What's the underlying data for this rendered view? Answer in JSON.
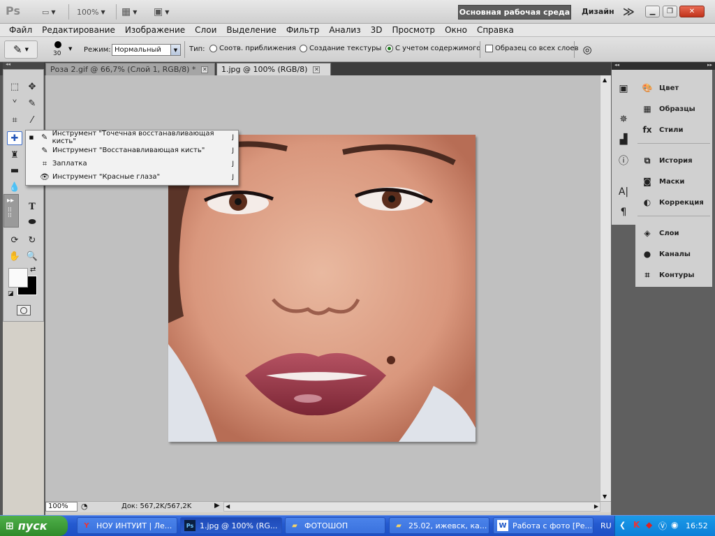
{
  "app": {
    "logo": "Ps",
    "zoom_preset": "100%",
    "workspace": "Основная рабочая среда",
    "workspace_alt": "Дизайн",
    "more": "≫"
  },
  "menu": [
    "Файл",
    "Редактирование",
    "Изображение",
    "Слои",
    "Выделение",
    "Фильтр",
    "Анализ",
    "3D",
    "Просмотр",
    "Окно",
    "Справка"
  ],
  "options": {
    "brush_size": "30",
    "mode_label": "Режим:",
    "mode_value": "Нормальный",
    "type_label": "Тип:",
    "radio_proximity": "Соотв. приближения",
    "radio_texture": "Создание текстуры",
    "radio_content": "С учетом содержимого",
    "sample_all_layers": "Образец со всех слоев"
  },
  "tabs": [
    {
      "title": "Роза 2.gif @ 66,7% (Слой 1, RGB/8) *",
      "active": false
    },
    {
      "title": "1.jpg @ 100% (RGB/8)",
      "active": true
    }
  ],
  "flyout": [
    {
      "label": "Инструмент \"Точечная восстанавливающая кисть\"",
      "key": "J",
      "selected": true
    },
    {
      "label": "Инструмент \"Восстанавливающая кисть\"",
      "key": "J",
      "selected": false
    },
    {
      "label": "Заплатка",
      "key": "J",
      "selected": false
    },
    {
      "label": "Инструмент \"Красные глаза\"",
      "key": "J",
      "selected": false
    }
  ],
  "status": {
    "zoom": "100%",
    "doc": "Док: 567,2K/567,2K"
  },
  "panels": [
    {
      "label": "Цвет",
      "icon": "color-icon"
    },
    {
      "label": "Образцы",
      "icon": "swatches-icon"
    },
    {
      "label": "Стили",
      "icon": "styles-icon"
    },
    {
      "label": "История",
      "icon": "history-icon"
    },
    {
      "label": "Маски",
      "icon": "masks-icon"
    },
    {
      "label": "Коррекция",
      "icon": "adjustments-icon"
    },
    {
      "label": "Слои",
      "icon": "layers-icon"
    },
    {
      "label": "Каналы",
      "icon": "channels-icon"
    },
    {
      "label": "Контуры",
      "icon": "paths-icon"
    }
  ],
  "taskbar": {
    "start": "пуск",
    "tasks": [
      {
        "label": "НОУ ИНТУИТ | Ле...",
        "icon": "yandex-browser-icon"
      },
      {
        "label": "1.jpg @ 100% (RG...",
        "icon": "photoshop-icon"
      },
      {
        "label": "ФОТОШОП",
        "icon": "folder-icon"
      },
      {
        "label": "25.02, ижевск, ка...",
        "icon": "folder-icon"
      },
      {
        "label": "Работа с фото [Ре...",
        "icon": "word-icon"
      }
    ],
    "lang": "RU",
    "clock": "16:52"
  }
}
